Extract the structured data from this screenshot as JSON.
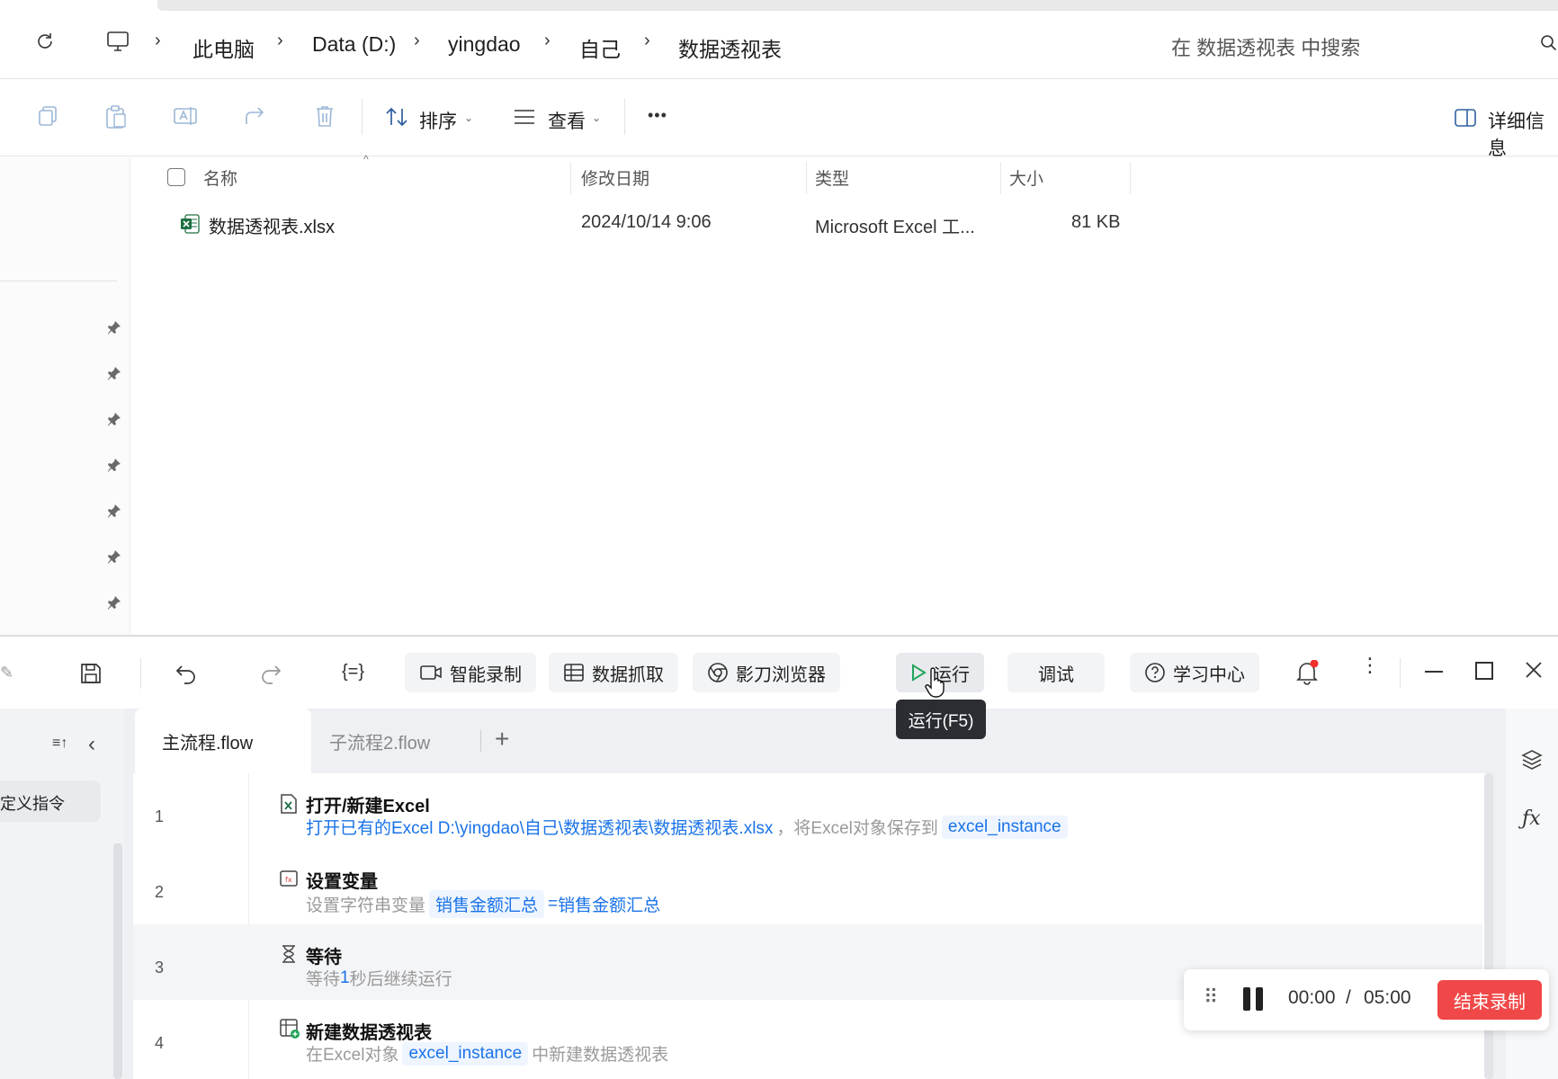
{
  "explorer": {
    "breadcrumb": [
      "此电脑",
      "Data (D:)",
      "yingdao",
      "自己",
      "数据透视表"
    ],
    "search_placeholder": "在 数据透视表 中搜索",
    "commands": {
      "sort": "排序",
      "view": "查看",
      "more": "•••",
      "details": "详细信息"
    },
    "columns": {
      "name": "名称",
      "modified": "修改日期",
      "type": "类型",
      "size": "大小"
    },
    "files": [
      {
        "name": "数据透视表.xlsx",
        "modified": "2024/10/14 9:06",
        "type": "Microsoft Excel 工...",
        "size": "81 KB"
      }
    ]
  },
  "rpa": {
    "toolbar": {
      "smart_record": "智能录制",
      "data_scrape": "数据抓取",
      "browser": "影刀浏览器",
      "run": "运行",
      "debug": "调试",
      "learn": "学习中心",
      "run_tooltip": "运行(F5)"
    },
    "left_panel": {
      "custom_cmd": "定义指令"
    },
    "tabs": [
      "主流程.flow",
      "子流程2.flow"
    ],
    "steps": [
      {
        "no": "1",
        "title": "打开/新建Excel",
        "desc_main": "打开已有的Excel D:\\yingdao\\自己\\数据透视表\\数据透视表.xlsx",
        "desc_mid": "，将Excel对象保存到",
        "var": "excel_instance"
      },
      {
        "no": "2",
        "title": "设置变量",
        "desc_pre": "设置字符串变量",
        "var": "销售金额汇总",
        "eq": "=",
        "value": "销售金额汇总"
      },
      {
        "no": "3",
        "title": "等待",
        "desc_pre": "等待",
        "num": "1",
        "desc_post": "秒后继续运行"
      },
      {
        "no": "4",
        "title": "新建数据透视表",
        "desc_pre": "在Excel对象",
        "var": "excel_instance",
        "desc_post": "中新建数据透视表"
      }
    ],
    "recorder": {
      "elapsed": "00:00",
      "sep": "/",
      "limit": "05:00",
      "stop": "结束录制"
    },
    "colors": {
      "accent": "#1a73e8",
      "stop": "#f04848",
      "run_green": "#22a55b"
    }
  }
}
